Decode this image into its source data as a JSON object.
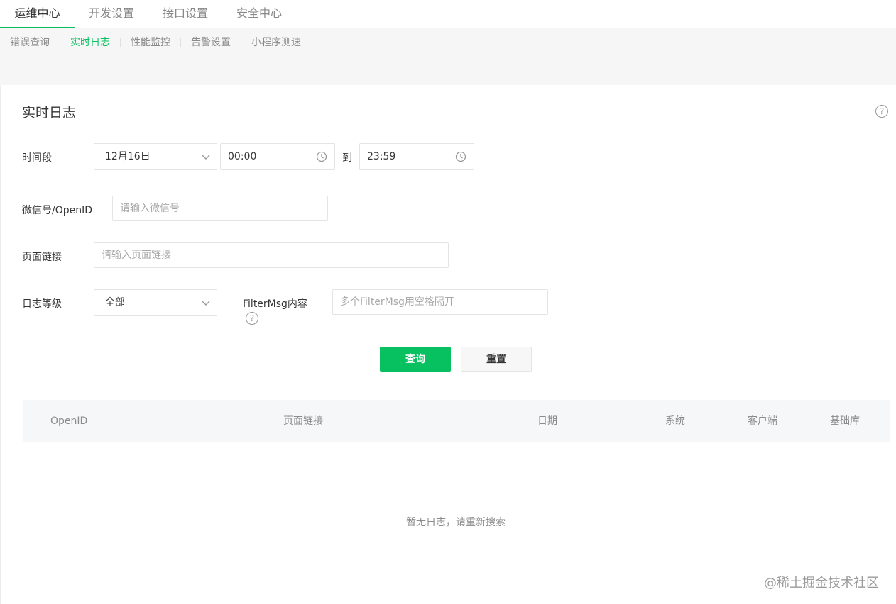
{
  "top_tabs": [
    {
      "label": "运维中心",
      "active": true
    },
    {
      "label": "开发设置",
      "active": false
    },
    {
      "label": "接口设置",
      "active": false
    },
    {
      "label": "安全中心",
      "active": false
    }
  ],
  "sub_nav": [
    {
      "label": "错误查询",
      "active": false
    },
    {
      "label": "实时日志",
      "active": true
    },
    {
      "label": "性能监控",
      "active": false
    },
    {
      "label": "告警设置",
      "active": false
    },
    {
      "label": "小程序测速",
      "active": false
    }
  ],
  "page": {
    "title": "实时日志"
  },
  "form": {
    "time_range": {
      "label": "时间段",
      "date": "12月16日",
      "start_time": "00:00",
      "to_label": "到",
      "end_time": "23:59"
    },
    "wechat_id": {
      "label": "微信号/OpenID",
      "placeholder": "请输入微信号",
      "value": ""
    },
    "page_link": {
      "label": "页面链接",
      "placeholder": "请输入页面链接",
      "value": ""
    },
    "log_level": {
      "label": "日志等级",
      "selected": "全部"
    },
    "filter_msg": {
      "label": "FilterMsg内容",
      "placeholder": "多个FilterMsg用空格隔开",
      "value": ""
    },
    "buttons": {
      "query": "查询",
      "reset": "重置"
    }
  },
  "table": {
    "columns": [
      "OpenID",
      "页面链接",
      "日期",
      "系统",
      "客户端",
      "基础库"
    ],
    "empty_text": "暂无日志，请重新搜索"
  },
  "watermark": "@稀土掘金技术社区",
  "colors": {
    "accent": "#07c160",
    "text": "#353535",
    "muted": "#8b8b8b"
  }
}
